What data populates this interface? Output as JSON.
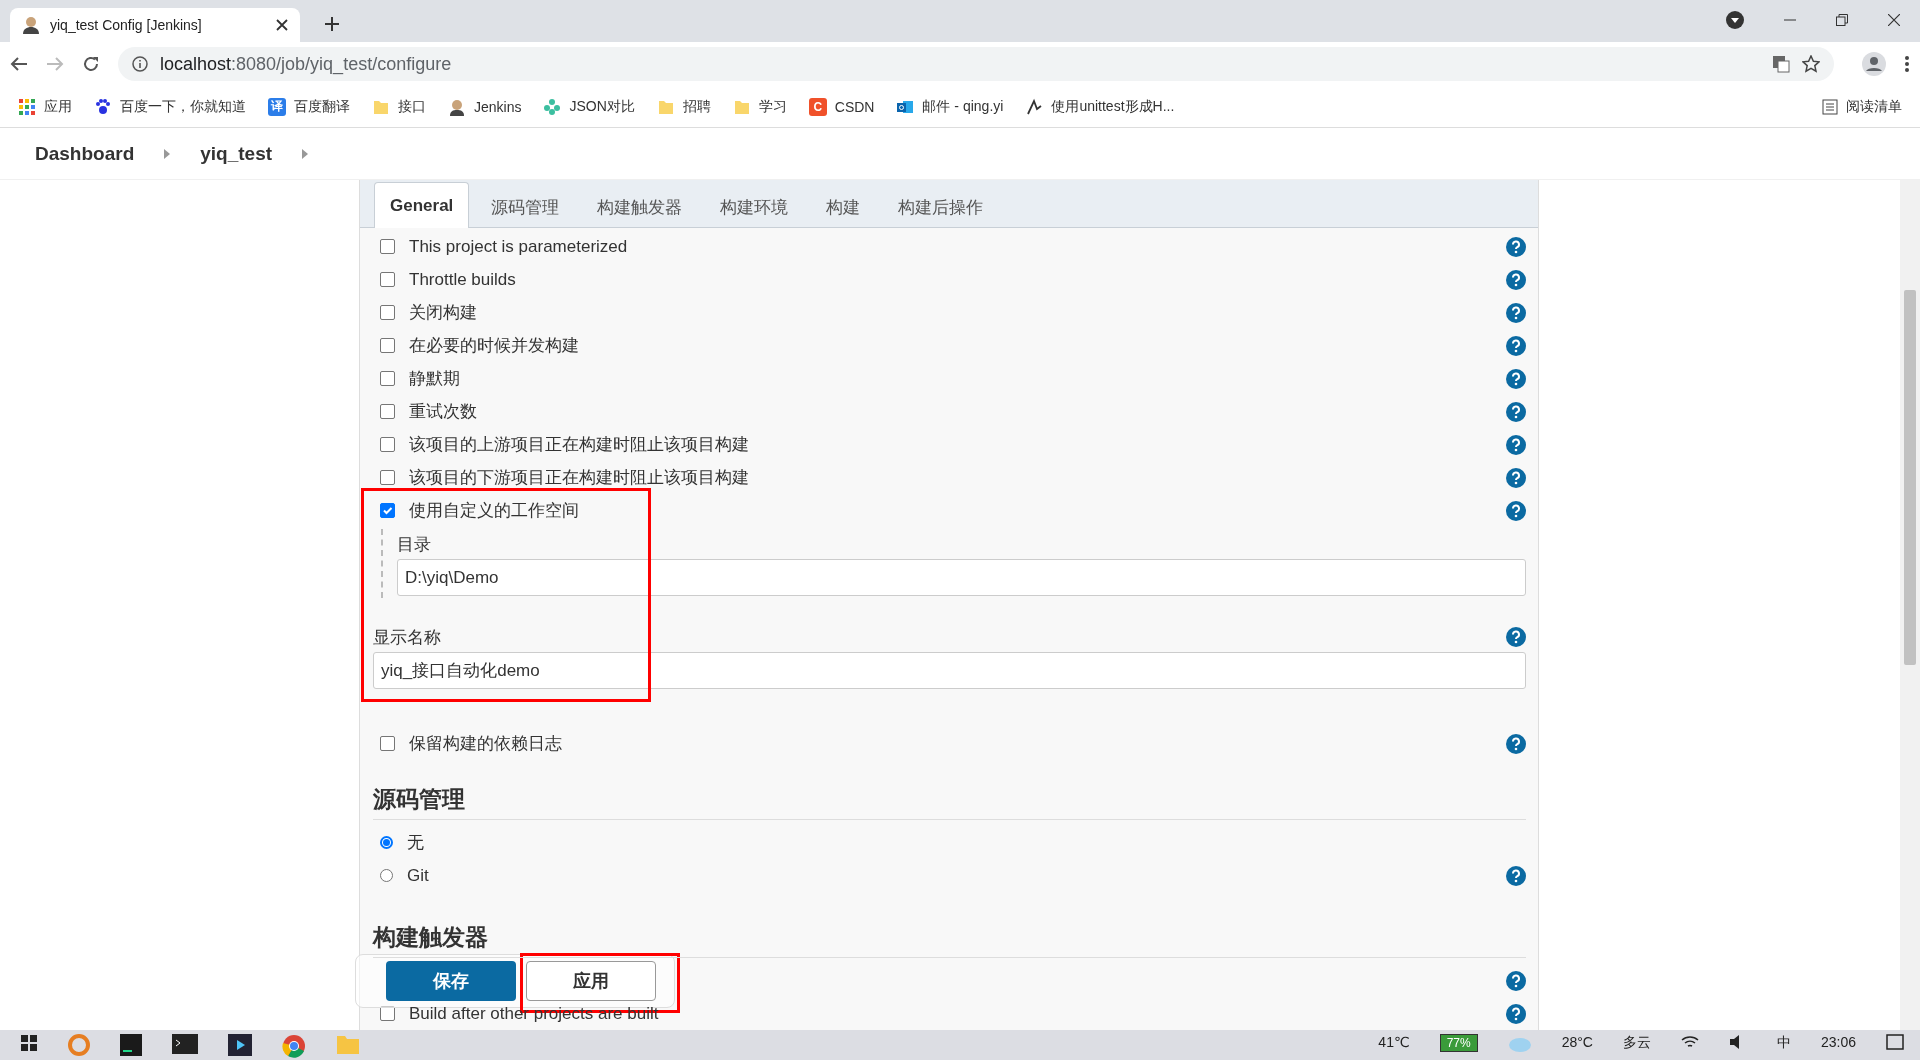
{
  "browser": {
    "tab_title": "yiq_test Config [Jenkins]",
    "url_host": "localhost",
    "url_path": ":8080/job/yiq_test/configure",
    "bookmarks": [
      {
        "kind": "apps",
        "label": "应用"
      },
      {
        "kind": "paw",
        "label": "百度一下，你就知道"
      },
      {
        "kind": "badge",
        "badge": "译",
        "color": "#2b7de9",
        "label": "百度翻译"
      },
      {
        "kind": "folder",
        "label": "接口"
      },
      {
        "kind": "avatar",
        "label": "Jenkins"
      },
      {
        "kind": "flower",
        "label": "JSON对比"
      },
      {
        "kind": "folder",
        "label": "招聘"
      },
      {
        "kind": "folder",
        "label": "学习"
      },
      {
        "kind": "badge",
        "badge": "C",
        "color": "#f0512a",
        "label": "CSDN"
      },
      {
        "kind": "mail",
        "label": "邮件 - qing.yi"
      },
      {
        "kind": "script",
        "label": "使用unittest形成H..."
      }
    ],
    "reading_list": "阅读清单"
  },
  "breadcrumbs": [
    "Dashboard",
    "yiq_test"
  ],
  "tabs": [
    {
      "label": "General",
      "selected": true
    },
    {
      "label": "源码管理",
      "selected": false
    },
    {
      "label": "构建触发器",
      "selected": false
    },
    {
      "label": "构建环境",
      "selected": false
    },
    {
      "label": "构建",
      "selected": false
    },
    {
      "label": "构建后操作",
      "selected": false
    }
  ],
  "general": [
    {
      "kind": "checkbox",
      "label": "This project is parameterized",
      "checked": false,
      "help": true
    },
    {
      "kind": "checkbox",
      "label": "Throttle builds",
      "checked": false,
      "help": true
    },
    {
      "kind": "checkbox",
      "label": "关闭构建",
      "checked": false,
      "help": true
    },
    {
      "kind": "checkbox",
      "label": "在必要的时候并发构建",
      "checked": false,
      "help": true
    },
    {
      "kind": "checkbox",
      "label": "静默期",
      "checked": false,
      "help": true
    },
    {
      "kind": "checkbox",
      "label": "重试次数",
      "checked": false,
      "help": true
    },
    {
      "kind": "checkbox",
      "label": "该项目的上游项目正在构建时阻止该项目构建",
      "checked": false,
      "help": true
    },
    {
      "kind": "checkbox",
      "label": "该项目的下游项目正在构建时阻止该项目构建",
      "checked": false,
      "help": true
    },
    {
      "kind": "checkbox",
      "label": "使用自定义的工作空间",
      "checked": true,
      "help": true,
      "highlighted": true,
      "fields": [
        {
          "label": "目录",
          "value": "D:\\yiq\\Demo"
        }
      ]
    },
    {
      "kind": "field",
      "label": "显示名称",
      "value": "yiq_接口自动化demo",
      "help": true,
      "highlighted": true
    },
    {
      "kind": "checkbox",
      "label": "保留构建的依赖日志",
      "checked": false,
      "help": true
    }
  ],
  "scm": {
    "title": "源码管理",
    "options": [
      {
        "label": "无",
        "selected": true
      },
      {
        "label": "Git",
        "selected": false,
        "help": true
      }
    ]
  },
  "triggers": {
    "title": "构建触发器",
    "options": [
      {
        "help": true
      },
      {
        "label": "Build after other projects are built",
        "checked": false,
        "help": true
      }
    ]
  },
  "buttons": [
    {
      "label": "保存",
      "kind": "primary"
    },
    {
      "label": "应用",
      "kind": "secondary",
      "highlighted": true
    }
  ],
  "taskbar": {
    "temperature": "41℃",
    "battery": "77%",
    "weather": "28°C",
    "weather_text": "多云",
    "ime": "中",
    "time": "23:06"
  }
}
